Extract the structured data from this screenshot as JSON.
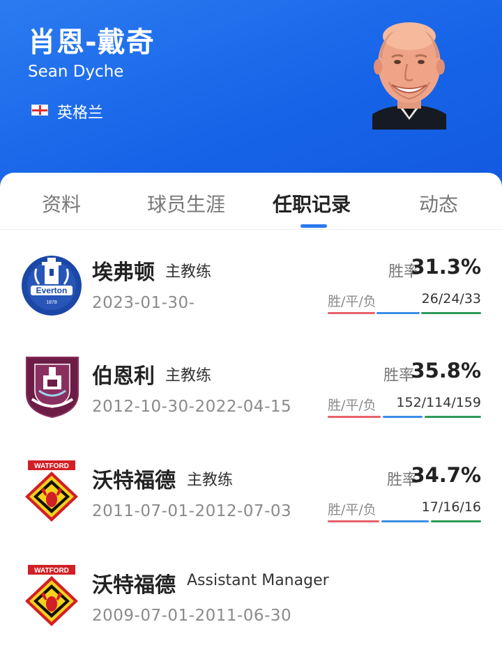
{
  "profile": {
    "name_cn": "肖恩-戴奇",
    "name_en": "Sean Dyche",
    "nation": "英格兰",
    "flag_icon": "england-flag-icon"
  },
  "tabs": [
    {
      "label": "资料",
      "active": false
    },
    {
      "label": "球员生涯",
      "active": false
    },
    {
      "label": "任职记录",
      "active": true
    },
    {
      "label": "动态",
      "active": false
    }
  ],
  "colors": {
    "header_blue": "#1764e8",
    "win": "#e8606a",
    "draw": "#3a8ee6",
    "loss": "#2e9a58",
    "accent": "#2a78ee"
  },
  "records": [
    {
      "club": "埃弗顿",
      "role": "主教练",
      "dates": "2023-01-30-",
      "win_rate_label": "胜率",
      "win_rate": "31.3%",
      "wdl_label": "胜/平/负",
      "wdl": "26/24/33",
      "logo_icon": "everton-crest-icon",
      "logo_text": "Everton",
      "logo_year": "1878"
    },
    {
      "club": "伯恩利",
      "role": "主教练",
      "dates": "2012-10-30-2022-04-15",
      "win_rate_label": "胜率",
      "win_rate": "35.8%",
      "wdl_label": "胜/平/负",
      "wdl": "152/114/159",
      "logo_icon": "burnley-crest-icon"
    },
    {
      "club": "沃特福德",
      "role": "主教练",
      "dates": "2011-07-01-2012-07-03",
      "win_rate_label": "胜率",
      "win_rate": "34.7%",
      "wdl_label": "胜/平/负",
      "wdl": "17/16/16",
      "logo_icon": "watford-crest-icon",
      "logo_text": "WATFORD"
    },
    {
      "club": "沃特福德",
      "role": "Assistant Manager",
      "dates": "2009-07-01-2011-06-30",
      "logo_icon": "watford-crest-icon",
      "logo_text": "WATFORD"
    }
  ]
}
